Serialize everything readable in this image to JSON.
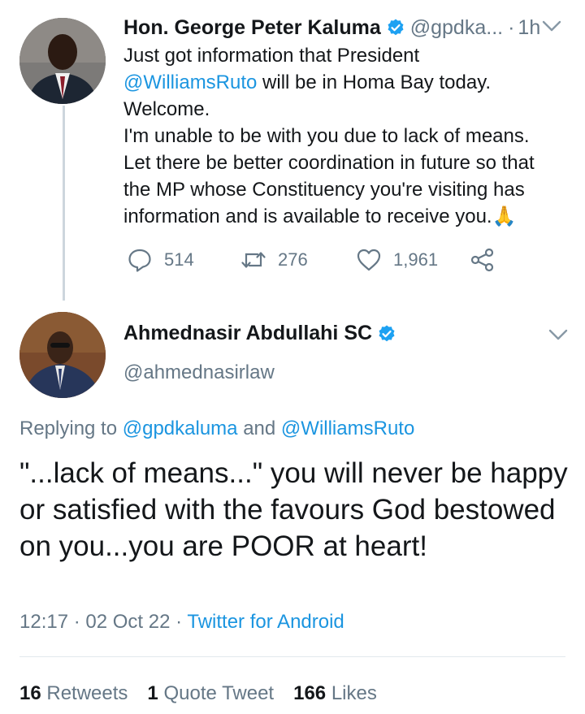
{
  "tweet1": {
    "name": "Hon. George Peter Kaluma",
    "handle": "@gpdka...",
    "dot": "·",
    "time": "1h",
    "line1": "Just got information that President",
    "mention": "@WilliamsRuto",
    "line2_rest": " will be in Homa Bay today.",
    "line3": "Welcome.",
    "line4": "I'm unable to be with you due to lack of means.",
    "line5": "Let there be better coordination in future so that",
    "line6": "the MP whose Constituency you're visiting has",
    "line7": "information and is available to receive you.",
    "emoji": "🙏",
    "replies": "514",
    "retweets": "276",
    "likes": "1,961"
  },
  "tweet2": {
    "name": "Ahmednasir Abdullahi SC",
    "handle": "@ahmednasirlaw",
    "replying_prefix": "Replying to ",
    "replying_user1": "@gpdkaluma",
    "replying_and": " and ",
    "replying_user2": "@WilliamsRuto",
    "text": "\"...lack of means...\" you will never be happy or satisfied with the favours God bestowed on you...you are POOR at heart!",
    "time": "12:17",
    "date": "02 Oct 22",
    "source": "Twitter for Android",
    "sep": " · "
  },
  "stats": {
    "retweets_count": "16",
    "retweets_label": "Retweets",
    "quotes_count": "1",
    "quotes_label": "Quote Tweet",
    "likes_count": "166",
    "likes_label": "Likes"
  },
  "colors": {
    "link": "#1b95e0",
    "muted": "#657786",
    "text": "#14171a"
  },
  "icons": {
    "verified": "verified-badge-icon",
    "reply": "reply-icon",
    "retweet": "retweet-icon",
    "like": "heart-icon",
    "share": "share-icon",
    "more": "chevron-down-icon"
  }
}
